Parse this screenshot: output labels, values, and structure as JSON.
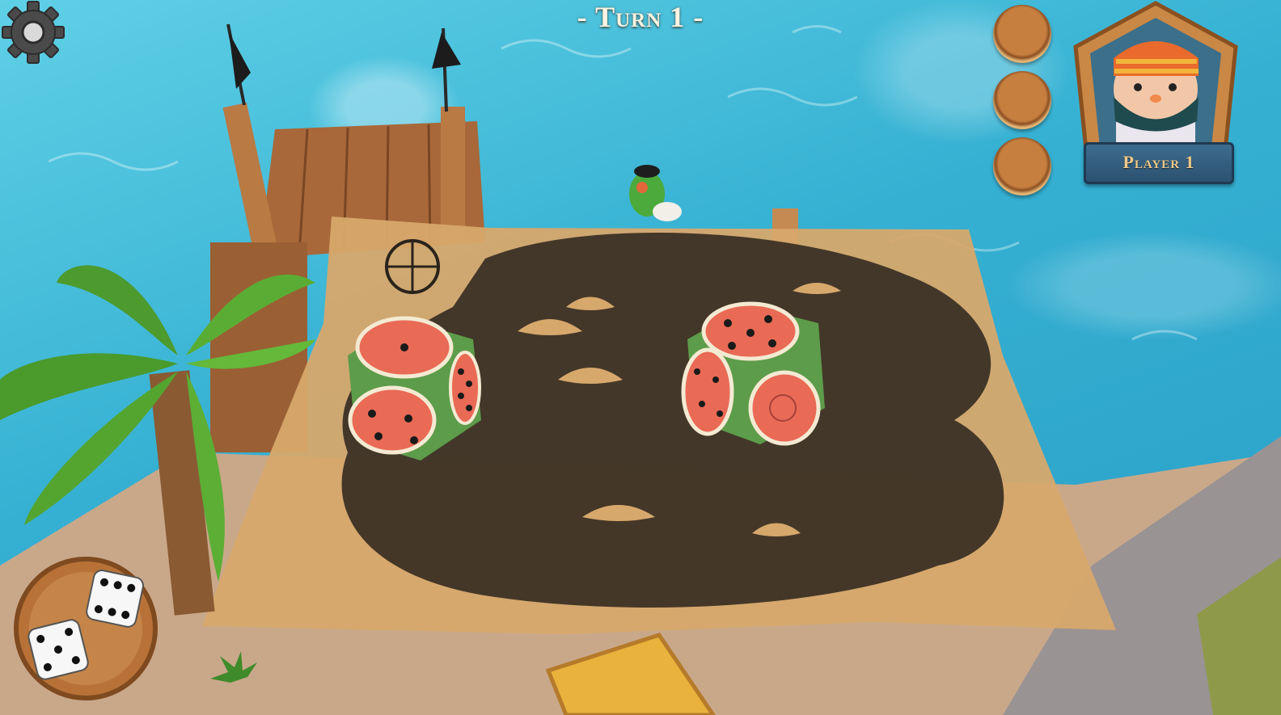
{
  "hud": {
    "turn_label": "- Turn 1 -",
    "player_name": "Player 1",
    "item_slots": [
      "empty",
      "empty",
      "empty"
    ]
  },
  "icons": {
    "settings": "gear-icon",
    "roll": "dice-icon",
    "avatar": "pirate-avatar"
  },
  "dice_result": [
    5,
    4
  ],
  "colors": {
    "ocean": "#38b3d2",
    "slot_wood": "#b87237",
    "banner": "#2f5676",
    "banner_text": "#f1c987",
    "hud_text": "#fbf4e2"
  }
}
